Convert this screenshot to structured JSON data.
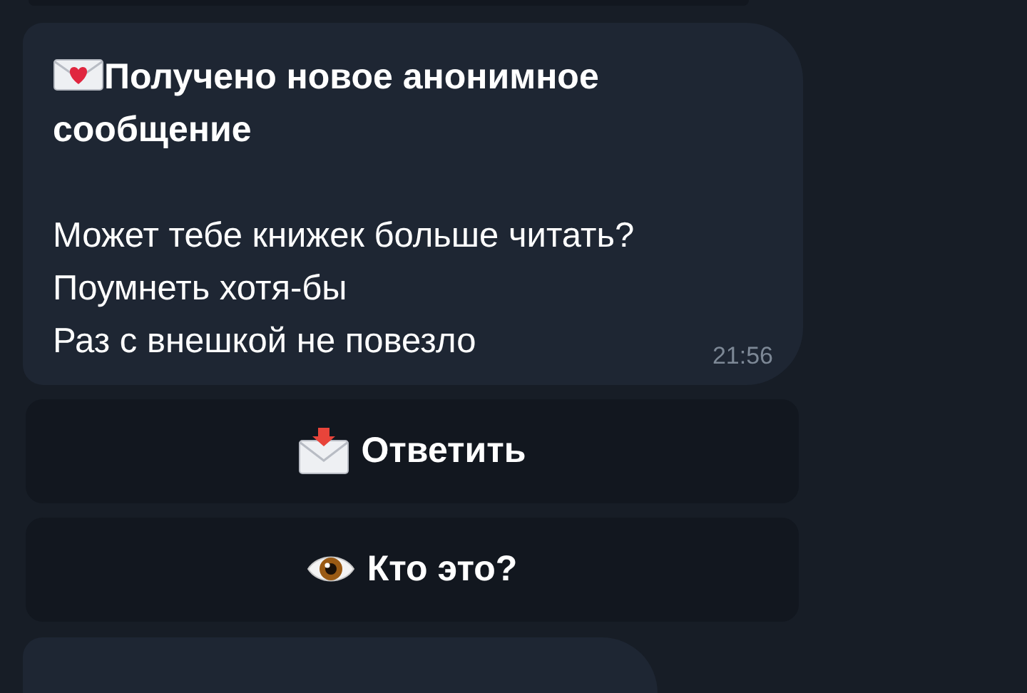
{
  "message": {
    "title": "Получено новое анонимное сообщение",
    "lines": [
      "Может тебе книжек больше читать?",
      "Поумнеть хотя-бы",
      "Раз с внешкой не повезло"
    ],
    "time": "21:56"
  },
  "buttons": [
    {
      "kind": "reply",
      "label": "Ответить"
    },
    {
      "kind": "reveal",
      "label": "Кто это?"
    }
  ]
}
